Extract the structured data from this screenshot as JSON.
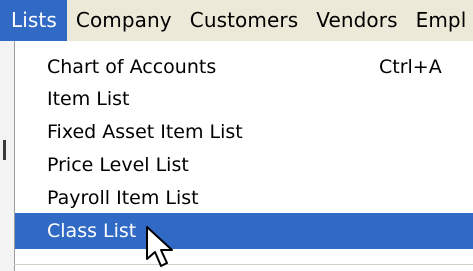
{
  "menubar": {
    "items": [
      {
        "label": "Lists"
      },
      {
        "label": "Company"
      },
      {
        "label": "Customers"
      },
      {
        "label": "Vendors"
      },
      {
        "label": "Empl"
      }
    ]
  },
  "menu": {
    "items": [
      {
        "label": "Chart of Accounts",
        "shortcut": "Ctrl+A"
      },
      {
        "label": "Item List"
      },
      {
        "label": "Fixed Asset Item List"
      },
      {
        "label": "Price Level List"
      },
      {
        "label": "Payroll Item List"
      },
      {
        "label": "Class List"
      }
    ]
  },
  "icons": {
    "cursor": "mouse-pointer-icon"
  },
  "colors": {
    "highlight": "#316ac5",
    "menubar_bg": "#ece9d8",
    "menu_bg": "#ffffff"
  }
}
